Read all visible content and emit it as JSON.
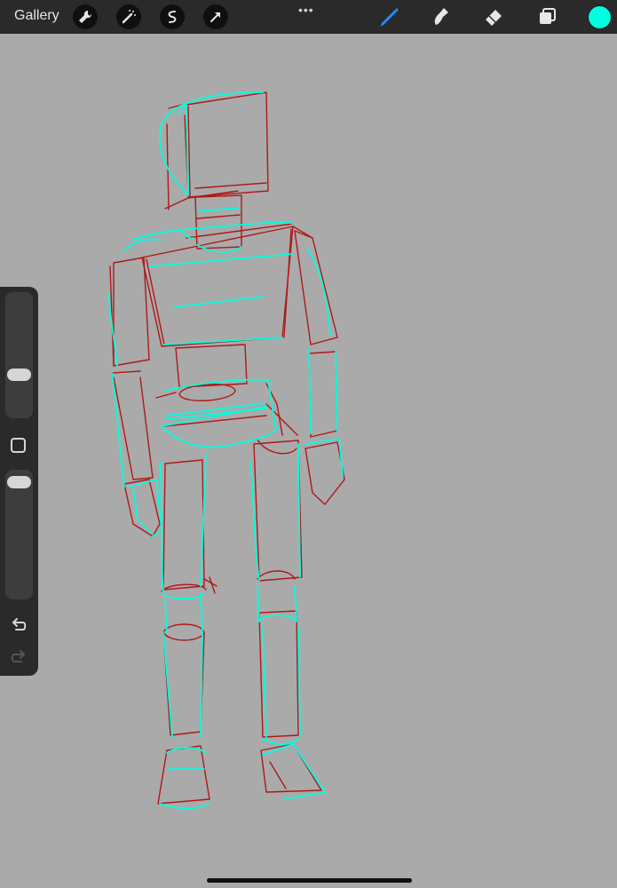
{
  "toolbar": {
    "gallery_label": "Gallery",
    "more_label": "•••",
    "left_tools": [
      "wrench-icon",
      "magic-wand-icon",
      "selection-icon",
      "transform-arrow-icon"
    ],
    "right_tools": [
      "brush-icon",
      "smudge-icon",
      "eraser-icon",
      "layers-icon"
    ],
    "active_tool": "brush-icon",
    "active_tool_color": "#1e8cff",
    "current_color": "#00ffe0"
  },
  "sidebar": {
    "brush_size_level": 0.65,
    "opacity_level": 1.0,
    "icons": [
      "modify-square-icon",
      "undo-icon",
      "redo-icon"
    ]
  },
  "canvas": {
    "background_color": "#aaaaaa",
    "stroke_colors": [
      "#b01818",
      "#00ffe0"
    ]
  }
}
